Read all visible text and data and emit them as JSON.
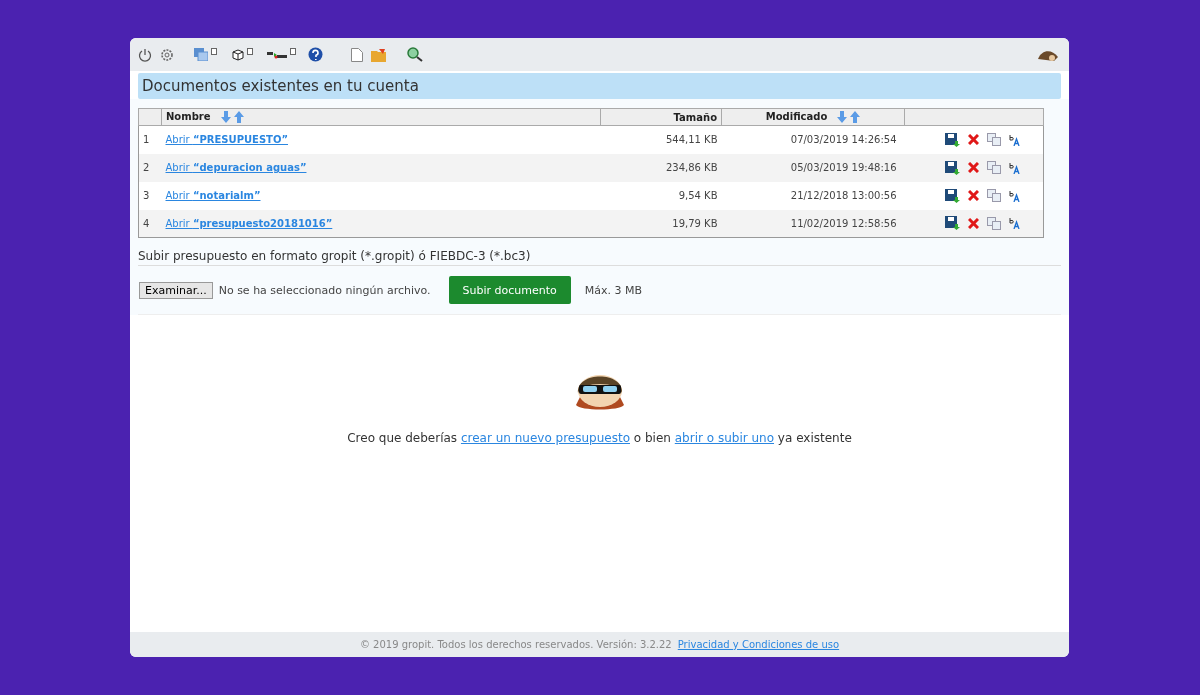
{
  "title": "Documentos existentes en tu cuenta",
  "table": {
    "columns": [
      "Nombre",
      "Tamaño",
      "Modificado"
    ],
    "rows": [
      {
        "index": "1",
        "name": "Abrir **“PRESUPUESTO”**",
        "size": "544,11 KB",
        "modified": "07/03/2019 14:26:54"
      },
      {
        "index": "2",
        "name": "Abrir **“depuracion aguas”**",
        "size": "234,86 KB",
        "modified": "05/03/2019 19:48:16"
      },
      {
        "index": "3",
        "name": "Abrir **“notarialm”**",
        "size": "9,54 KB",
        "modified": "21/12/2018 13:00:56"
      },
      {
        "index": "4",
        "name": "Abrir **“presupuesto20181016”**",
        "size": "19,79 KB",
        "modified": "11/02/2019 12:58:56"
      }
    ]
  },
  "upload": {
    "heading": "Subir presupuesto en formato gropit (*.gropit) ó FIEBDC-3 (*.bc3)",
    "browse": "Examinar...",
    "no_file": "No se ha seleccionado ningún archivo.",
    "submit": "Subir documento",
    "max": "Máx. 3 MB"
  },
  "message": [
    {
      "kind": "text",
      "text": "Creo que deberías"
    },
    {
      "kind": "link",
      "text": "crear un nuevo presupuesto"
    },
    {
      "kind": "text",
      "text": "o bien"
    },
    {
      "kind": "link",
      "text": "abrir o subir uno"
    },
    {
      "kind": "text",
      "text": "ya existente"
    }
  ],
  "footer": {
    "text": "© 2019 gropit. Todos los derechos reservados. Versión: 3.2.22",
    "link": "Privacidad y Condiciones de uso"
  }
}
